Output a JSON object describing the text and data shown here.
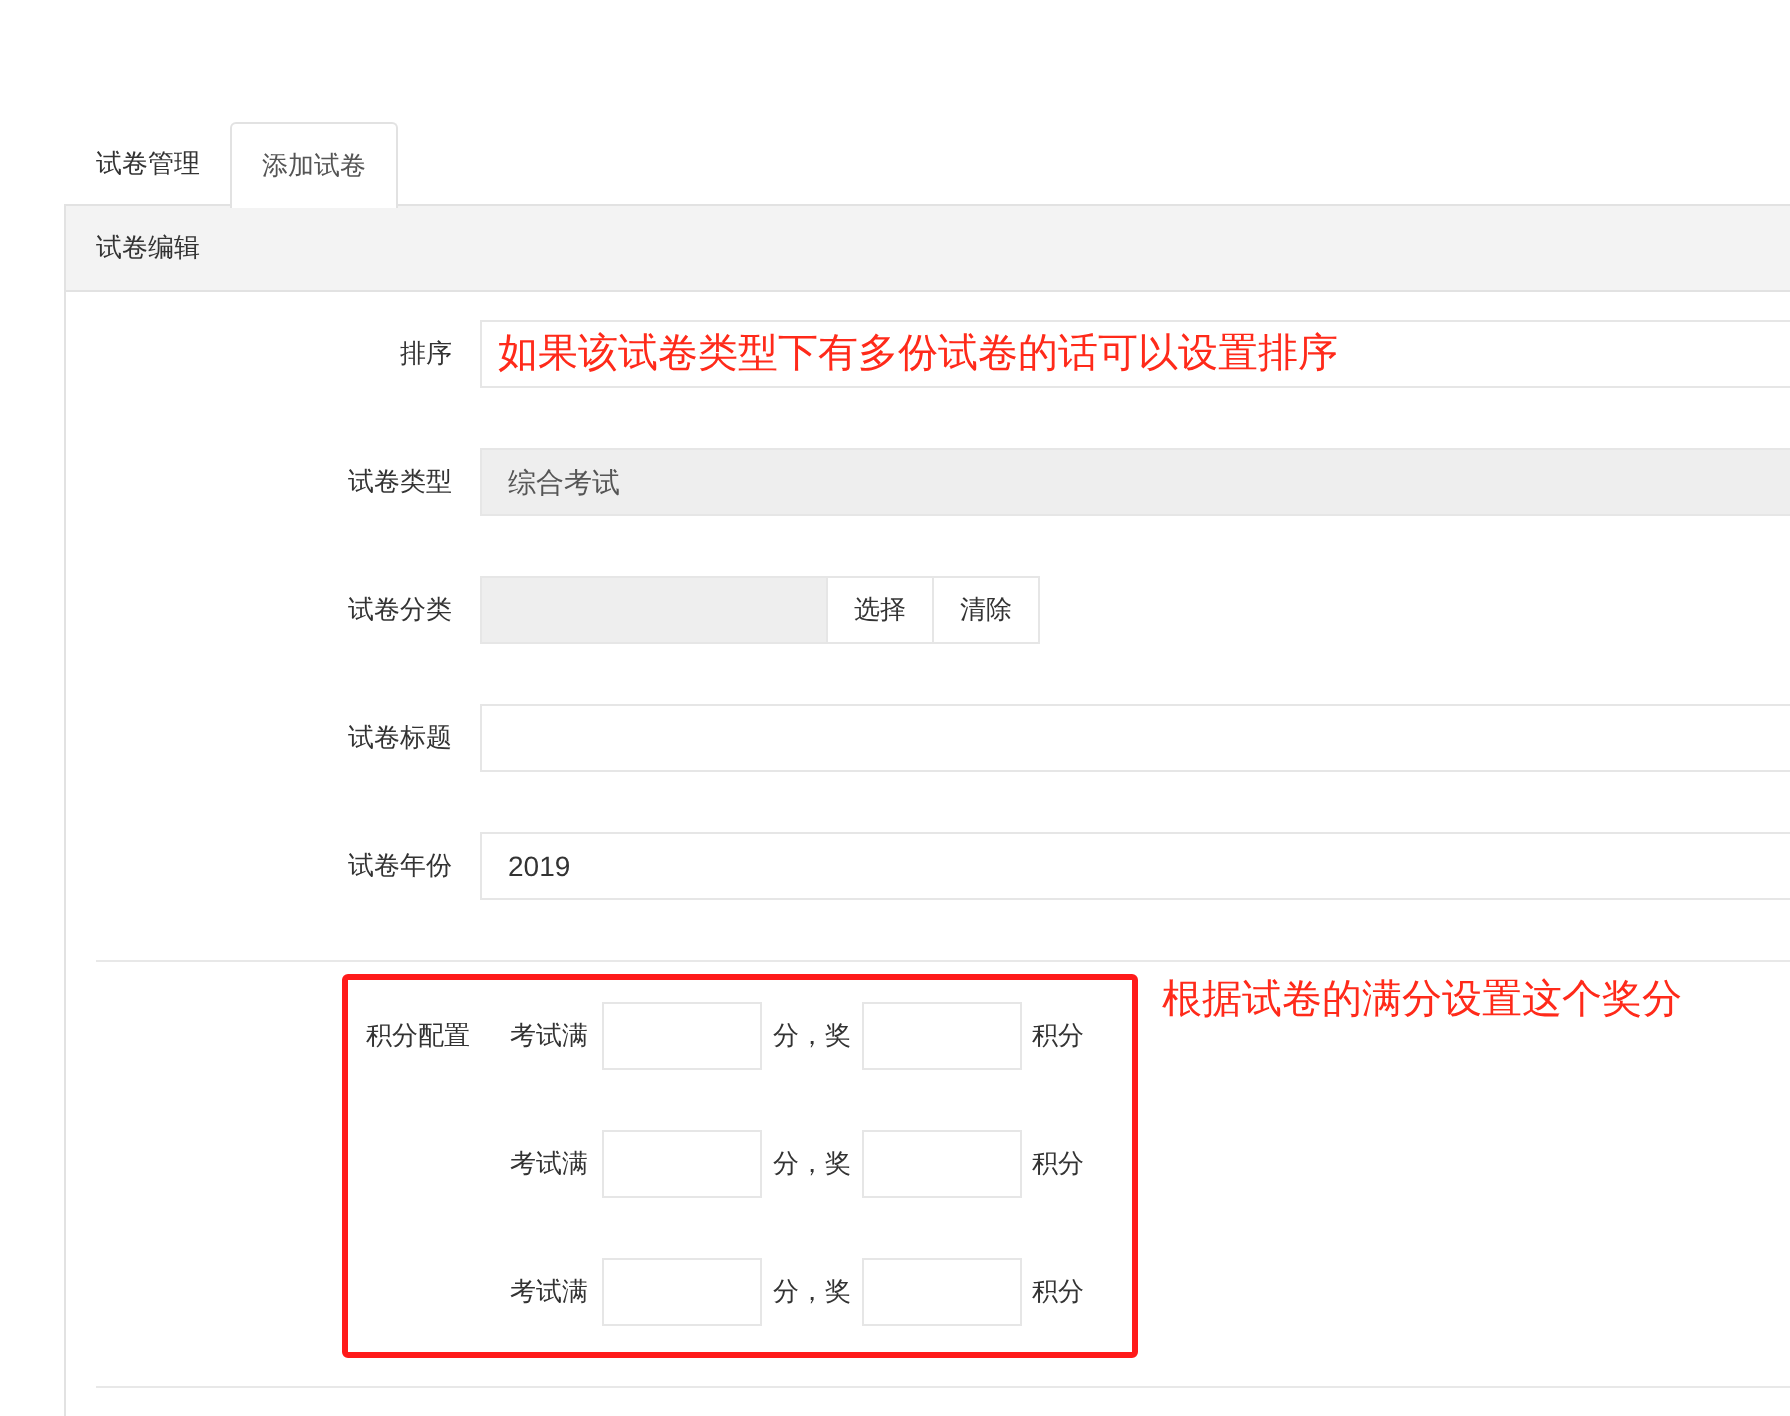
{
  "tabs": [
    {
      "label": "试卷管理",
      "selected": false
    },
    {
      "label": "添加试卷",
      "selected": true
    }
  ],
  "panel": {
    "title": "试卷编辑",
    "fields": [
      {
        "kind": "text",
        "label": "排序",
        "annotation": "如果该试卷类型下有多份试卷的话可以设置排序"
      },
      {
        "kind": "readonly",
        "label": "试卷类型",
        "value": "综合考试"
      },
      {
        "kind": "picker",
        "label": "试卷分类",
        "buttons": [
          "选择",
          "清除"
        ]
      },
      {
        "kind": "text",
        "label": "试卷标题"
      },
      {
        "kind": "text",
        "label": "试卷年份",
        "value": "2019"
      }
    ],
    "score_config": {
      "label": "积分配置",
      "annotation": "根据试卷的满分设置这个奖分",
      "rows": [
        {
          "prefix": "考试满",
          "middle": "分，奖",
          "suffix": "积分"
        },
        {
          "prefix": "考试满",
          "middle": "分，奖",
          "suffix": "积分"
        },
        {
          "prefix": "考试满",
          "middle": "分，奖",
          "suffix": "积分"
        }
      ]
    }
  }
}
